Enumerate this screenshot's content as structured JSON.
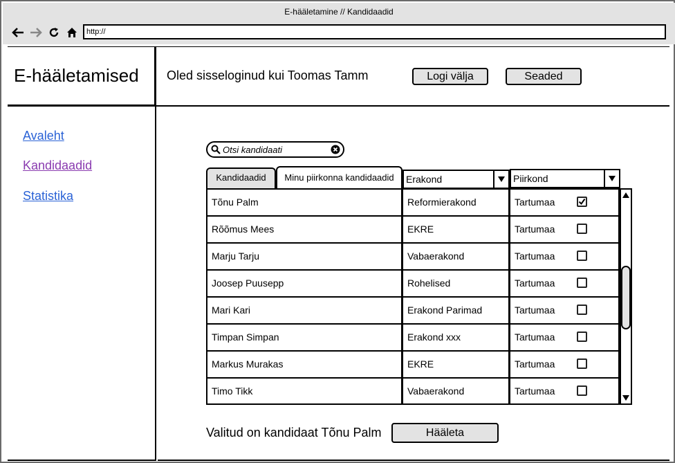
{
  "browser": {
    "title": "E-hääletamine // Kandidaadid",
    "url": "http://"
  },
  "header": {
    "logo": "E-hääletamised",
    "login_text": "Oled sisseloginud kui Toomas Tamm",
    "logout_label": "Logi välja",
    "settings_label": "Seaded"
  },
  "sidebar": {
    "items": [
      {
        "label": "Avaleht"
      },
      {
        "label": "Kandidaadid"
      },
      {
        "label": "Statistika"
      }
    ]
  },
  "search": {
    "placeholder": "Otsi kandidaati"
  },
  "tabs": [
    {
      "label": "Kandidaadid"
    },
    {
      "label": "Minu piirkonna kandidaadid"
    }
  ],
  "filters": {
    "party": "Erakond",
    "district": "Piirkond"
  },
  "candidates": [
    {
      "name": "Tõnu Palm",
      "party": "Reformierakond",
      "district": "Tartumaa",
      "checked": true
    },
    {
      "name": "Rõõmus Mees",
      "party": "EKRE",
      "district": "Tartumaa",
      "checked": false
    },
    {
      "name": "Marju Tarju",
      "party": "Vabaerakond",
      "district": "Tartumaa",
      "checked": false
    },
    {
      "name": "Joosep Puusepp",
      "party": "Rohelised",
      "district": "Tartumaa",
      "checked": false
    },
    {
      "name": "Mari Kari",
      "party": "Erakond Parimad",
      "district": "Tartumaa",
      "checked": false
    },
    {
      "name": "Timpan Simpan",
      "party": "Erakond xxx",
      "district": "Tartumaa",
      "checked": false
    },
    {
      "name": "Markus Murakas",
      "party": "EKRE",
      "district": "Tartumaa",
      "checked": false
    },
    {
      "name": "Timo Tikk",
      "party": "Vabaerakond",
      "district": "Tartumaa",
      "checked": false
    }
  ],
  "footer": {
    "selected_text": "Valitud on kandidaat Tõnu Palm",
    "vote_label": "Hääleta"
  }
}
